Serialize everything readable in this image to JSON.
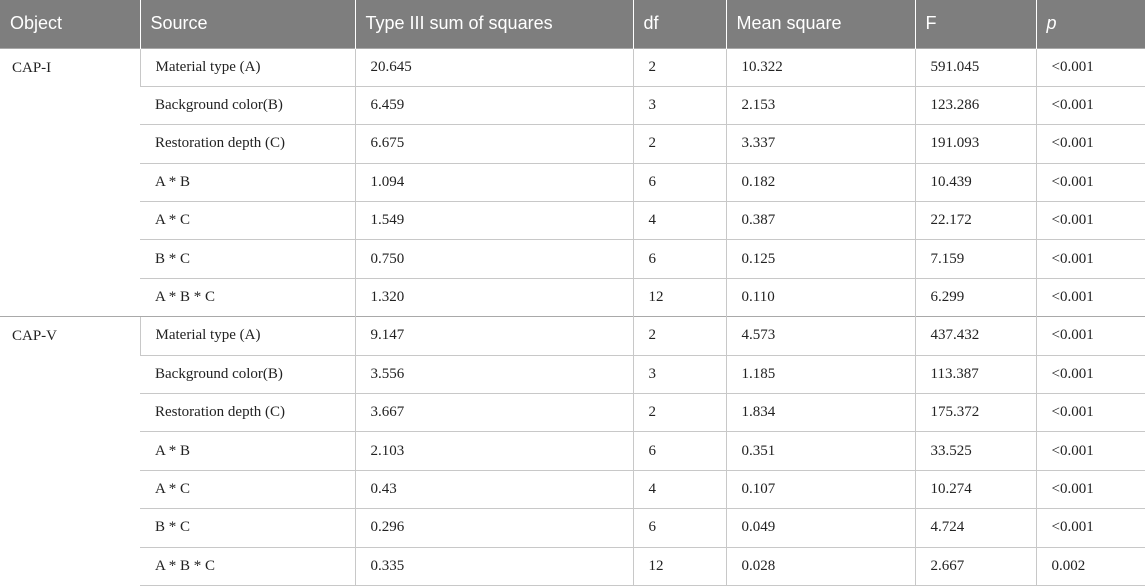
{
  "headers": [
    "Object",
    "Source",
    "Type III sum of squares",
    "df",
    "Mean square",
    "F",
    "p"
  ],
  "groups": [
    {
      "object": "CAP-I",
      "rows": [
        [
          "Material type (A)",
          "20.645",
          "2",
          "10.322",
          "591.045",
          "<0.001"
        ],
        [
          "Background color(B)",
          "6.459",
          "3",
          "2.153",
          "123.286",
          "<0.001"
        ],
        [
          "Restoration depth (C)",
          "6.675",
          "2",
          "3.337",
          "191.093",
          "<0.001"
        ],
        [
          "A * B",
          "1.094",
          "6",
          "0.182",
          "10.439",
          "<0.001"
        ],
        [
          "A * C",
          "1.549",
          "4",
          "0.387",
          "22.172",
          "<0.001"
        ],
        [
          "B * C",
          "0.750",
          "6",
          "0.125",
          "7.159",
          "<0.001"
        ],
        [
          "A * B * C",
          "1.320",
          "12",
          "0.110",
          "6.299",
          "<0.001"
        ]
      ]
    },
    {
      "object": "CAP-V",
      "rows": [
        [
          "Material type (A)",
          "9.147",
          "2",
          "4.573",
          "437.432",
          "<0.001"
        ],
        [
          "Background color(B)",
          "3.556",
          "3",
          "1.185",
          "113.387",
          "<0.001"
        ],
        [
          "Restoration depth (C)",
          "3.667",
          "2",
          "1.834",
          "175.372",
          "<0.001"
        ],
        [
          "A * B",
          "2.103",
          "6",
          "0.351",
          "33.525",
          "<0.001"
        ],
        [
          "A * C",
          "0.43",
          "4",
          "0.107",
          "10.274",
          "<0.001"
        ],
        [
          "B * C",
          "0.296",
          "6",
          "0.049",
          "4.724",
          "<0.001"
        ],
        [
          "A * B * C",
          "0.335",
          "12",
          "0.028",
          "2.667",
          "0.002"
        ]
      ]
    }
  ]
}
